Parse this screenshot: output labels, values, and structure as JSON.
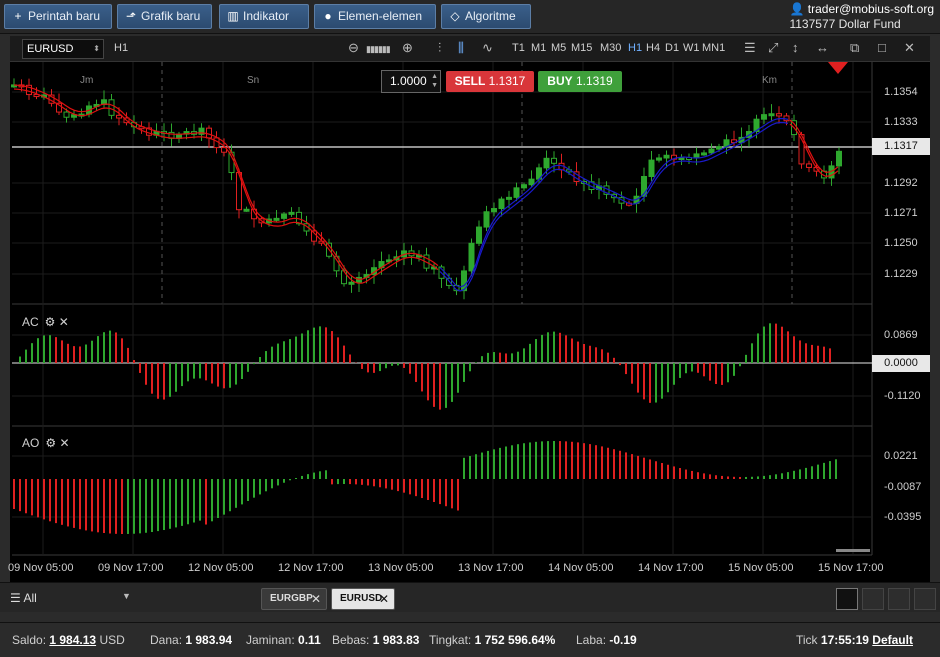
{
  "toolbar": {
    "new_order": "Perintah baru",
    "new_chart": "Grafik baru",
    "indicator": "Indikator",
    "elements": "Elemen-elemen",
    "algorithm": "Algoritme"
  },
  "account": {
    "email": "trader@mobius-soft.org",
    "id": "1137577",
    "fund": "Dollar Fund"
  },
  "chart_toolbar": {
    "symbol": "EURUSD",
    "timeframe": "H1",
    "timeframes": [
      "T1",
      "M1",
      "M5",
      "M15",
      "M30",
      "H1",
      "H4",
      "D1",
      "W1",
      "MN1"
    ],
    "active_timeframe": "H1"
  },
  "trade": {
    "quantity": "1.0000",
    "sell_label": "SELL",
    "sell_price": "1.1317",
    "buy_label": "BUY",
    "buy_price": "1.1319"
  },
  "price_axis": [
    "1.1354",
    "1.1333",
    "1.1292",
    "1.1271",
    "1.1250",
    "1.1229"
  ],
  "current_price": "1.1317",
  "ac_axis": [
    "0.0869",
    "0.0000",
    "-0.1120"
  ],
  "ao_axis": [
    "0.0221",
    "-0.0087",
    "-0.0395"
  ],
  "panels": {
    "ac": "AC",
    "ao": "AO"
  },
  "day_labels": [
    "Jm",
    "Sn",
    "Km"
  ],
  "time_axis": [
    "09 Nov 05:00",
    "09 Nov 17:00",
    "12 Nov 05:00",
    "12 Nov 17:00",
    "13 Nov 05:00",
    "13 Nov 17:00",
    "14 Nov 05:00",
    "14 Nov 17:00",
    "15 Nov 05:00",
    "15 Nov 17:00"
  ],
  "tabs": {
    "filter": "All",
    "items": [
      "EURGBP",
      "EURUSD"
    ],
    "active": "EURUSD"
  },
  "status": {
    "saldo_label": "Saldo:",
    "saldo": "1 984.13",
    "saldo_cur": "USD",
    "dana_label": "Dana:",
    "dana": "1 983.94",
    "jaminan_label": "Jaminan:",
    "jaminan": "0.11",
    "bebas_label": "Bebas:",
    "bebas": "1 983.83",
    "tingkat_label": "Tingkat:",
    "tingkat": "1 752 596.64%",
    "laba_label": "Laba:",
    "laba": "-0.19",
    "tick_label": "Tick",
    "time": "17:55:19",
    "default": "Default"
  },
  "colors": {
    "up": "#2ea82e",
    "down": "#e02020",
    "ma_red": "#e01010",
    "ma_blue": "#1a1acc"
  }
}
